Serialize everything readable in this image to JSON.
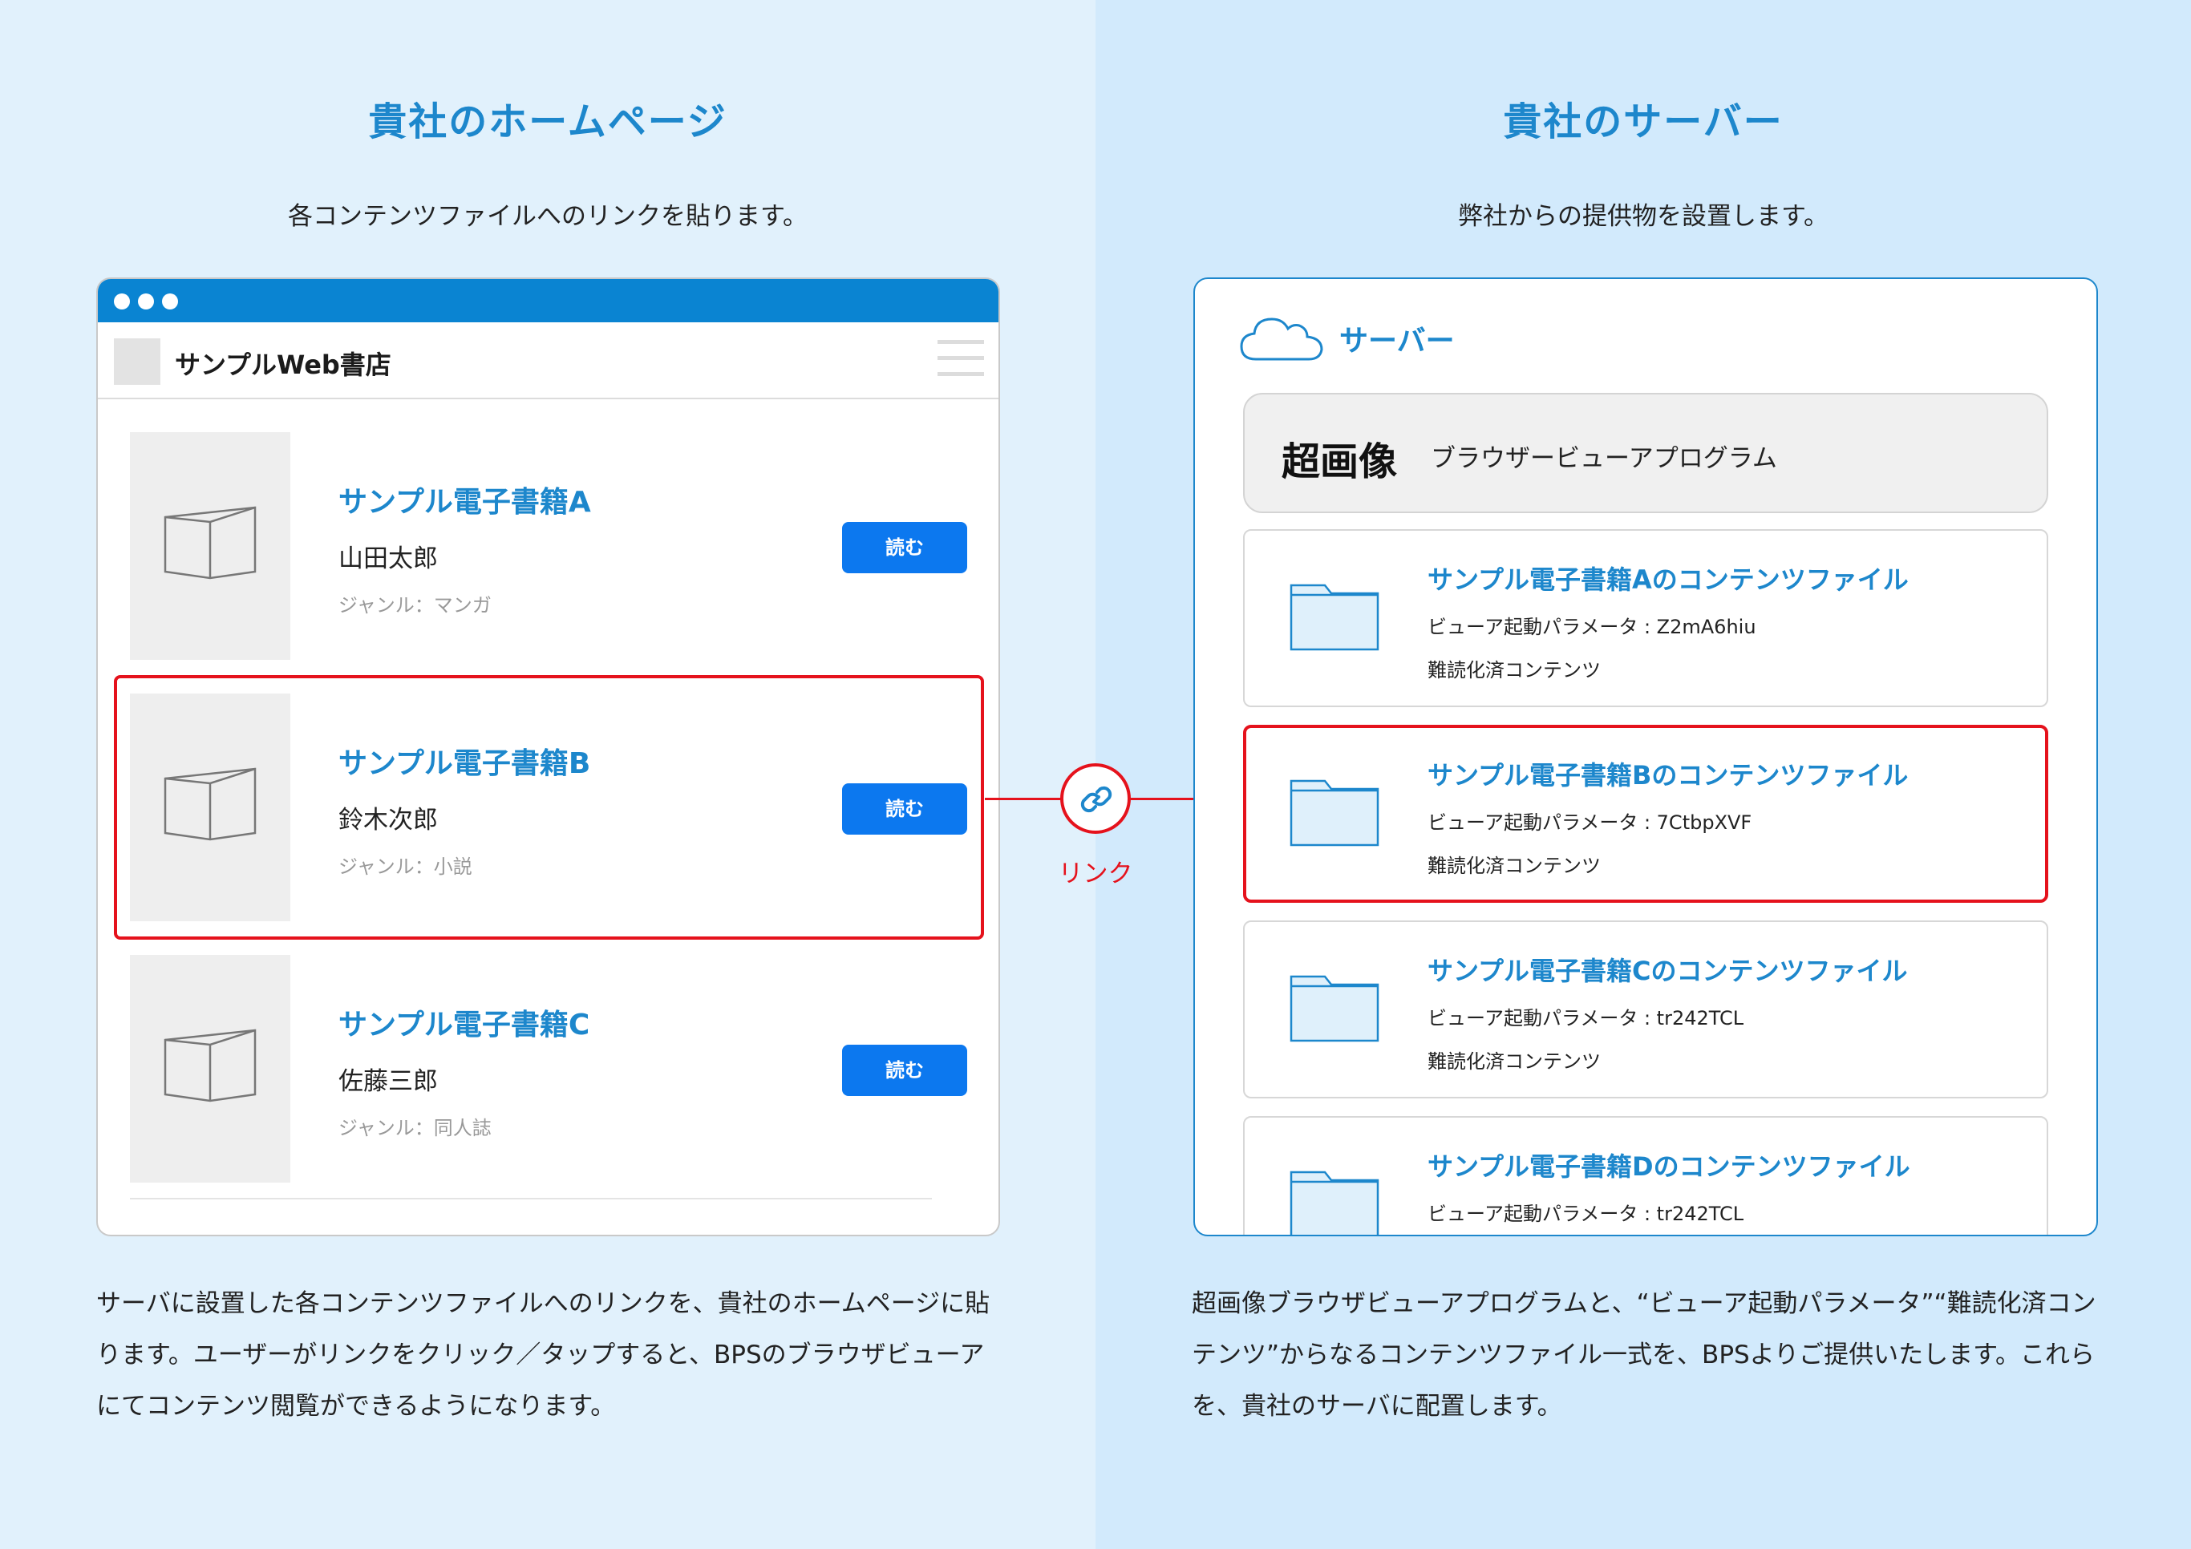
{
  "left": {
    "title": "貴社のホームページ",
    "subtitle": "各コンテンツファイルへのリンクを貼ります。",
    "site_title": "サンプルWeb書店",
    "books": [
      {
        "title": "サンプル電子書籍A",
        "author": "山田太郎",
        "genre": "ジャンル：マンガ",
        "button": "読む"
      },
      {
        "title": "サンプル電子書籍B",
        "author": "鈴木次郎",
        "genre": "ジャンル：小説",
        "button": "読む"
      },
      {
        "title": "サンプル電子書籍C",
        "author": "佐藤三郎",
        "genre": "ジャンル：同人誌",
        "button": "読む"
      }
    ],
    "description": "サーバに設置した各コンテンツファイルへのリンクを、貴社のホームページに貼ります。ユーザーがリンクをクリック／タップすると、BPSのブラウザビューアにてコンテンツ閲覧ができるようになります。"
  },
  "link": {
    "label": "リンク"
  },
  "right": {
    "title": "貴社のサーバー",
    "subtitle": "弊社からの提供物を設置します。",
    "server_label": "サーバー",
    "program_logo": "超画像",
    "program_name": "ブラウザービューアプログラム",
    "files": [
      {
        "title": "サンプル電子書籍Aのコンテンツファイル",
        "param": "ビューア起動パラメータ : Z2mA6hiu",
        "drm": "難読化済コンテンツ"
      },
      {
        "title": "サンプル電子書籍Bのコンテンツファイル",
        "param": "ビューア起動パラメータ : 7CtbpXVF",
        "drm": "難読化済コンテンツ"
      },
      {
        "title": "サンプル電子書籍Cのコンテンツファイル",
        "param": "ビューア起動パラメータ : tr242TCL",
        "drm": "難読化済コンテンツ"
      },
      {
        "title": "サンプル電子書籍Dのコンテンツファイル",
        "param": "ビューア起動パラメータ : tr242TCL",
        "drm": ""
      }
    ],
    "description": "超画像ブラウザビューアプログラムと、“ビューア起動パラメータ”“難読化済コンテンツ”からなるコンテンツファイル一式を、BPSよりご提供いたします。これらを、貴社のサーバに配置します。"
  },
  "colors": {
    "accent": "#1d87cc",
    "highlight": "#e5121c",
    "button": "#0c78ef"
  }
}
